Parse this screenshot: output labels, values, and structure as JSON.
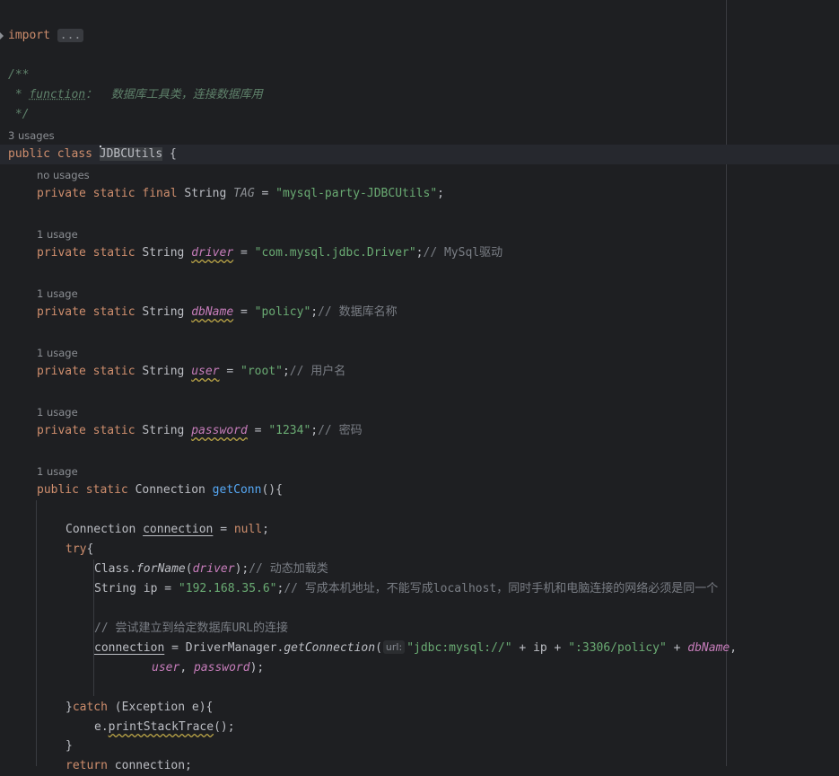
{
  "imports": {
    "keyword": "import",
    "folded": "..."
  },
  "doc_comment": {
    "open": "/**",
    "tag": "function",
    "text": "：  数据库工具类，连接数据库用",
    "close": " */"
  },
  "hints": {
    "class_usages": "3 usages",
    "tag_usages": "no usages",
    "driver_usages": "1 usage",
    "dbname_usages": "1 usage",
    "user_usages": "1 usage",
    "password_usages": "1 usage",
    "getconn_usages": "1 usage"
  },
  "class_decl": {
    "modifiers": "public class ",
    "name": "JDBCUtils",
    "brace": " {"
  },
  "fields": {
    "tag": {
      "mods": "private static final ",
      "type": "String ",
      "name": "TAG",
      "eq": " = ",
      "value": "\"mysql-party-JDBCUtils\"",
      "end": ";"
    },
    "driver": {
      "mods": "private static ",
      "type": "String ",
      "name": "driver",
      "eq": " = ",
      "value": "\"com.mysql.jdbc.Driver\"",
      "end": ";",
      "comment": "// MySql驱动"
    },
    "dbname": {
      "mods": "private static ",
      "type": "String ",
      "name": "dbName",
      "eq": " = ",
      "value": "\"policy\"",
      "end": ";",
      "comment": "// 数据库名称"
    },
    "user": {
      "mods": "private static ",
      "type": "String ",
      "name": "user",
      "eq": " = ",
      "value": "\"root\"",
      "end": ";",
      "comment": "// 用户名"
    },
    "password": {
      "mods": "private static ",
      "type": "String ",
      "name": "password",
      "eq": " = ",
      "value": "\"1234\"",
      "end": ";",
      "comment": "// 密码"
    }
  },
  "method": {
    "mods": "public static ",
    "type": "Connection ",
    "name": "getConn",
    "sig_end": "(){"
  },
  "body": {
    "conn_type": "Connection ",
    "conn_var": "connection",
    "conn_eq": " = ",
    "conn_null": "null",
    "conn_end": ";",
    "try_kw": "try",
    "try_brace": "{",
    "class_prefix": "Class.",
    "forname": "forName",
    "forname_open": "(",
    "forname_arg": "driver",
    "forname_close": ");",
    "forname_comment": "// 动态加载类",
    "ip_decl": "String ip = ",
    "ip_value": "\"192.168.35.6\"",
    "ip_end": ";",
    "ip_comment": "// 写成本机地址，不能写成localhost，同时手机和电脑连接的网络必须是同一个",
    "attempt_comment": "// 尝试建立到给定数据库URL的连接",
    "conn_assign": "connection",
    "dm_call": " = DriverManager.",
    "getconnection": "getConnection",
    "gc_open": "(",
    "url_hint": "url:",
    "url_str": "\"jdbc:mysql://\"",
    "plus_ip": " + ip + ",
    "port_str": "\":3306/policy\"",
    "plus": " + ",
    "dbname_ref": "dbName",
    "comma": ",",
    "user_ref": "user",
    "comma2": ", ",
    "password_ref": "password",
    "gc_close": ");",
    "catch_close": "}",
    "catch_kw": "catch",
    "catch_params": " (Exception e){",
    "e_prefix": "e.",
    "print_stack": "printStackTrace",
    "print_end": "();",
    "close_brace": "}",
    "return_kw": "return",
    "return_rest": " connection;"
  }
}
